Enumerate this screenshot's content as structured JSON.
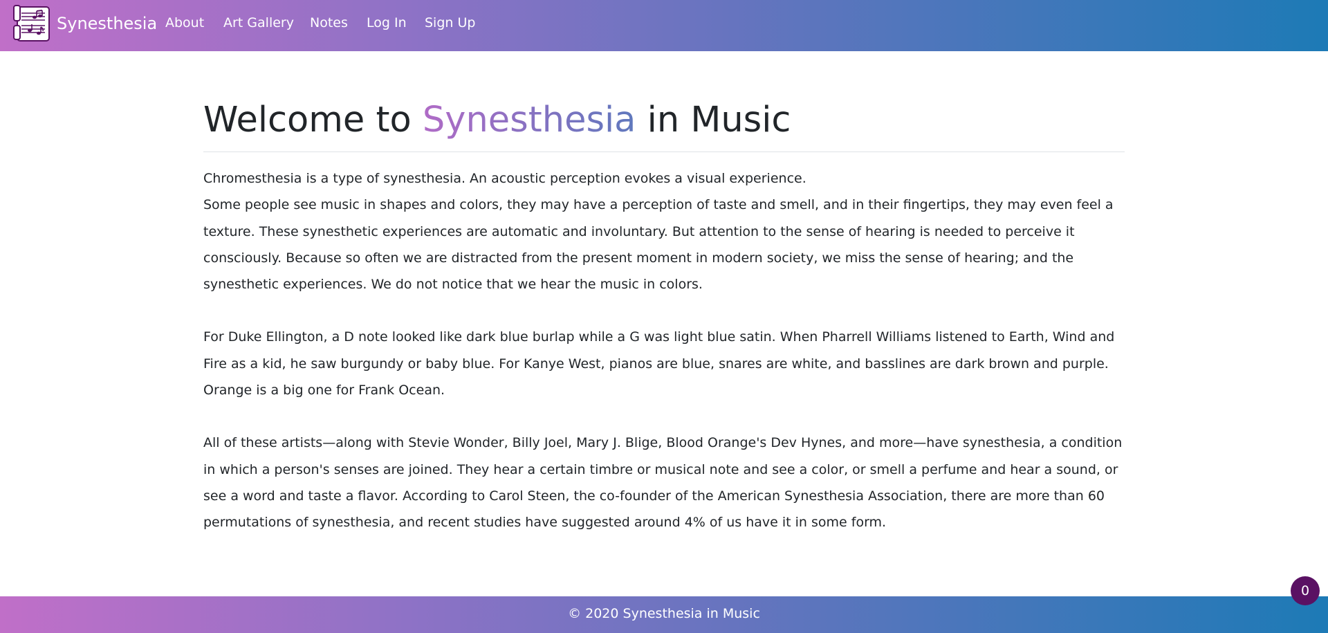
{
  "header": {
    "brand": "Synesthesia",
    "logo_icon": "music-notes-scroll-icon",
    "nav": [
      {
        "label": "About"
      },
      {
        "label": "Art Gallery"
      },
      {
        "label": "Notes"
      },
      {
        "label": "Log In"
      },
      {
        "label": "Sign Up"
      }
    ],
    "gradient_colors": [
      "#c06fc8",
      "#1d7ab6"
    ]
  },
  "main": {
    "title_prefix": "Welcome to ",
    "title_highlight": "Synesthesia",
    "title_suffix": " in Music",
    "paragraph1": {
      "line1": "Chromesthesia is a type of synesthesia. An acoustic perception evokes a visual experience.",
      "line2": "Some people see music in shapes and colors, they may have a perception of taste and smell, and in their fingertips, they may even feel a texture. These synesthetic experiences are automatic and involuntary. But attention to the sense of hearing is needed to perceive it consciously. Because so often we are distracted from the present moment in modern society, we miss the sense of hearing; and the synesthetic experiences. We do not notice that we hear the music in colors."
    },
    "paragraph2": "For Duke Ellington, a D note looked like dark blue burlap while a G was light blue satin. When Pharrell Williams listened to Earth, Wind and Fire as a kid, he saw burgundy or baby blue. For Kanye West, pianos are blue, snares are white, and basslines are dark brown and purple. Orange is a big one for Frank Ocean.",
    "paragraph3": "All of these artists—along with Stevie Wonder, Billy Joel, Mary J. Blige, Blood Orange's Dev Hynes, and more—have synesthesia, a condition in which a person's senses are joined. They hear a certain timbre or musical note and see a color, or smell a perfume and hear a sound, or see a word and taste a flavor. According to Carol Steen, the co-founder of the American Synesthesia Association, there are more than 60 permutations of synesthesia, and recent studies have suggested around 4% of us have it in some form."
  },
  "footer": {
    "text": "© 2020 Synesthesia in Music"
  },
  "badge": {
    "count": "0",
    "color": "#5a1163"
  }
}
